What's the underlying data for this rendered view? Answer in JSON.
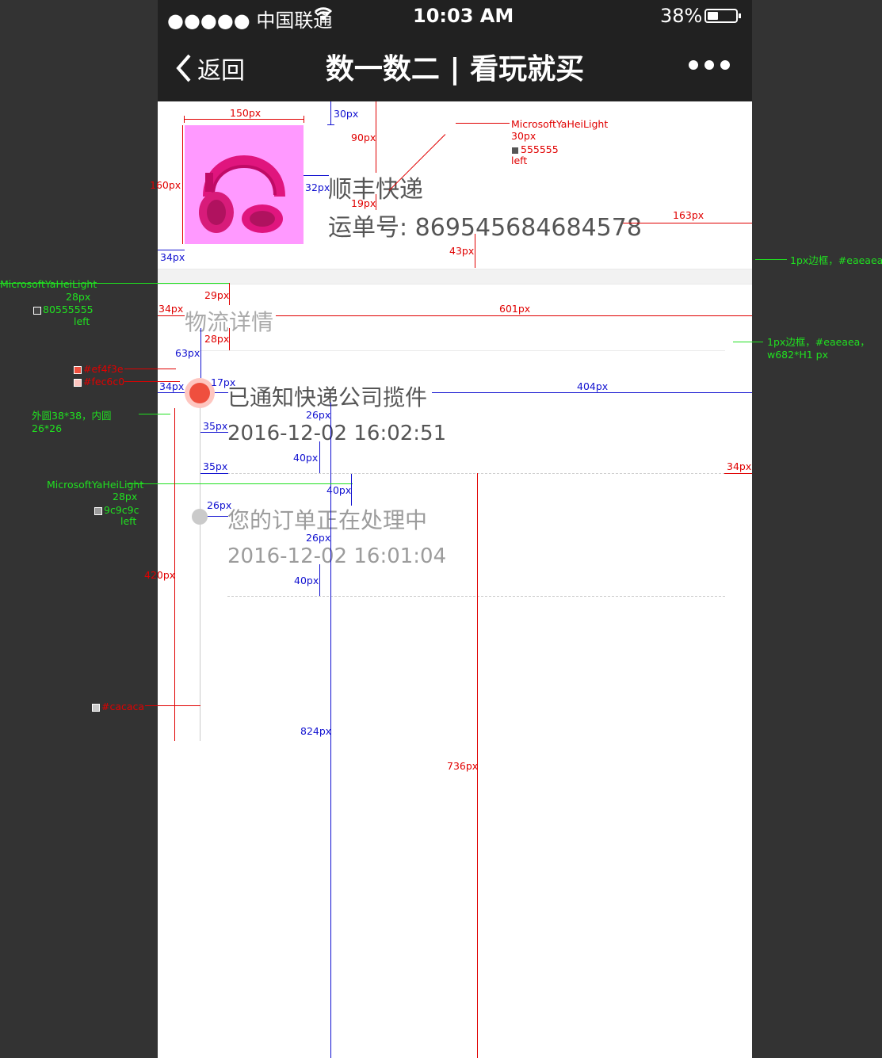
{
  "status_bar": {
    "carrier": "●●●●● 中国联通",
    "time": "10:03 AM",
    "battery": "38%",
    "battery_level": 0.38
  },
  "nav": {
    "back_label": "返回",
    "title": "数一数二 | 看玩就买"
  },
  "shipment": {
    "carrier_name": "顺丰快递",
    "tracking_label": "运单号: 869545684684578"
  },
  "section_title": "物流详情",
  "timeline": [
    {
      "text": "已通知快递公司揽件",
      "time": "2016-12-02 16:02:51",
      "active": true
    },
    {
      "text": "您的订单正在处理中",
      "time": "2016-12-02 16:01:04",
      "active": false
    }
  ],
  "colors": {
    "bg_dark": "#212121",
    "text_main": "#555555",
    "text_muted": "#9c9c9c",
    "border": "#eaeaea",
    "active_outer": "#fec6c0",
    "active_inner": "#ef4f3e",
    "inactive_dot": "#cacaca",
    "product_bg": "#ff99ff"
  },
  "annotations": {
    "dim_150": "150px",
    "dim_30": "30px",
    "dim_90": "90px",
    "dim_160": "160px",
    "dim_32": "32px",
    "dim_19": "19px",
    "dim_163": "163px",
    "dim_43": "43px",
    "dim_34a": "34px",
    "font1_name": "MicrosoftYaHeiLight",
    "font1_size": "30px",
    "font1_color": "555555",
    "font1_align": "left",
    "border1": "1px边框，#eaeaea",
    "font2_name": "MicrosoftYaHeiLight",
    "font2_size": "28px",
    "font2_color": "80555555",
    "font2_align": "left",
    "dim_29": "29px",
    "dim_34b": "34px",
    "dim_601": "601px",
    "dim_28": "28px",
    "dim_63": "63px",
    "border2_a": "1px边框，#eaeaea，",
    "border2_b": "w682*H1 px",
    "color_inner": "#ef4f3e",
    "color_outer": "#fec6c0",
    "dim_34c": "34px",
    "dim_17": "17px",
    "dim_404": "404px",
    "circle_a": "外圆38*38，内圆",
    "circle_b": "26*26",
    "dim_26a": "26px",
    "dim_35a": "35px",
    "dim_40a": "40px",
    "dim_35b": "35px",
    "dim_34d": "34px",
    "font3_name": "MicrosoftYaHeiLight",
    "font3_size": "28px",
    "font3_color": "9c9c9c",
    "font3_align": "left",
    "dim_40b": "40px",
    "dim_26b": "26px",
    "dim_420": "420px",
    "dim_26c": "26px",
    "dim_40c": "40px",
    "color_line": "#cacaca",
    "dim_824": "824px",
    "dim_736": "736px"
  }
}
